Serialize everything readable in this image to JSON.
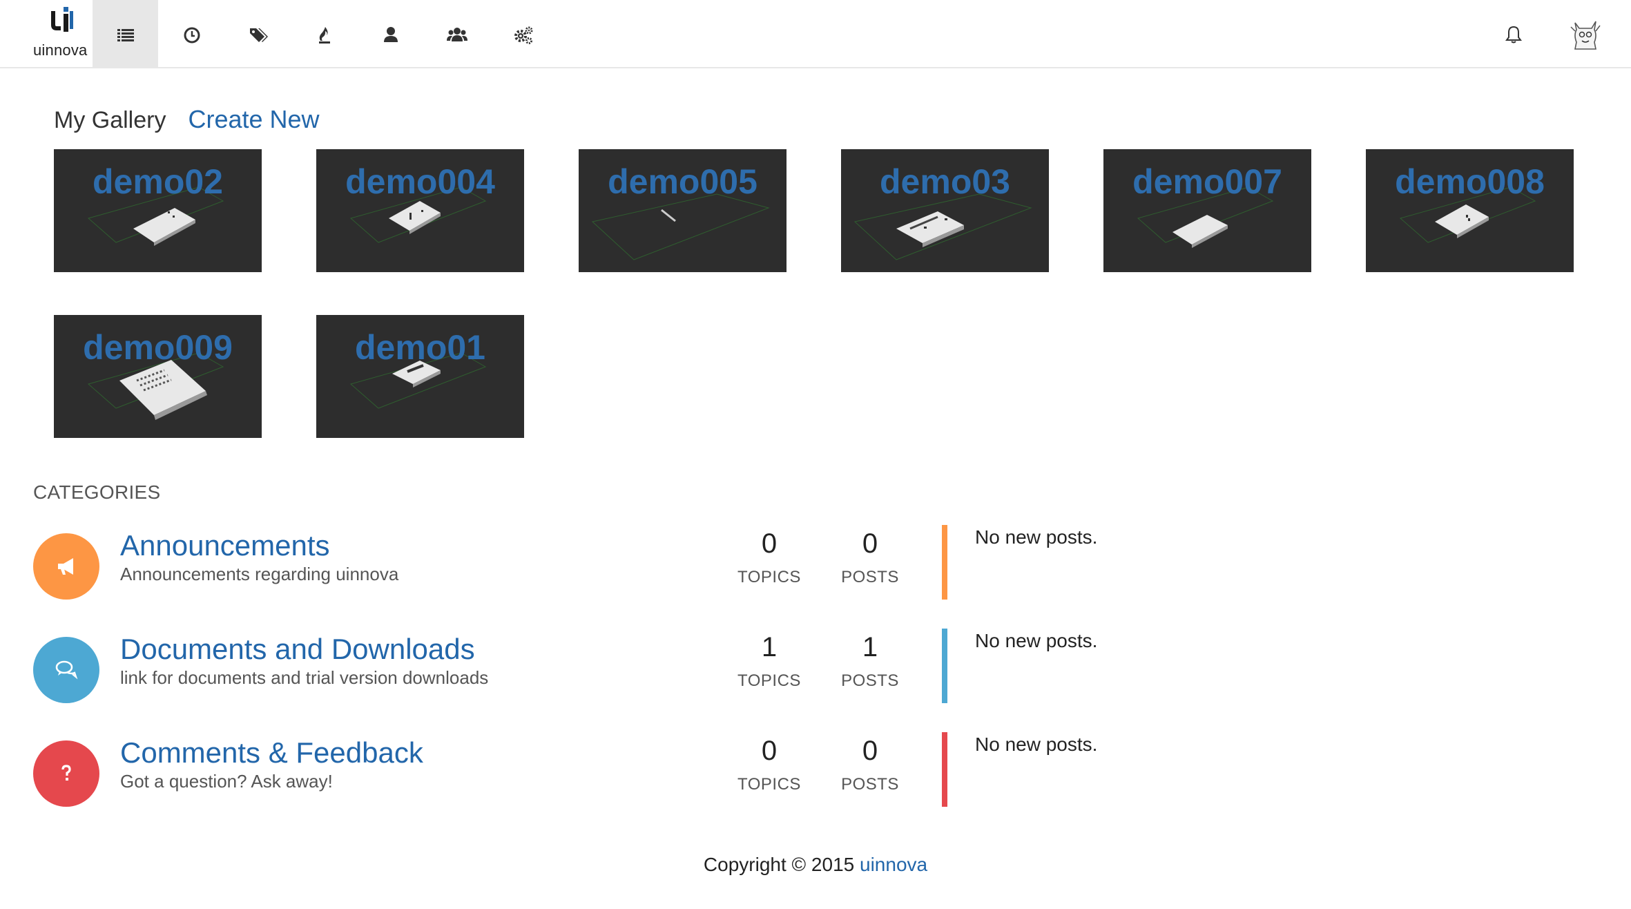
{
  "brand": {
    "name": "uinnova",
    "logo_icon": "uinnova-logo-icon"
  },
  "nav": {
    "items": [
      {
        "icon": "list-icon",
        "active": true
      },
      {
        "icon": "clock-icon",
        "active": false
      },
      {
        "icon": "tags-icon",
        "active": false
      },
      {
        "icon": "fire-icon",
        "active": false
      },
      {
        "icon": "user-icon",
        "active": false
      },
      {
        "icon": "users-icon",
        "active": false
      },
      {
        "icon": "gears-icon",
        "active": false
      }
    ],
    "right": [
      {
        "icon": "bell-icon"
      },
      {
        "icon": "avatar"
      }
    ]
  },
  "gallery": {
    "title": "My Gallery",
    "create_label": "Create New",
    "items": [
      {
        "label": "demo02"
      },
      {
        "label": "demo004"
      },
      {
        "label": "demo005"
      },
      {
        "label": "demo03"
      },
      {
        "label": "demo007"
      },
      {
        "label": "demo008"
      },
      {
        "label": "demo009"
      },
      {
        "label": "demo01"
      }
    ]
  },
  "categories": {
    "heading": "CATEGORIES",
    "items": [
      {
        "title": "Announcements",
        "description": "Announcements regarding uinnova",
        "topics": "0",
        "posts": "0",
        "topics_label": "TOPICS",
        "posts_label": "POSTS",
        "last_post": "No new posts.",
        "color": "#fd9644",
        "icon": "bullhorn-icon"
      },
      {
        "title": "Documents and Downloads",
        "description": "link for documents and trial version downloads",
        "topics": "1",
        "posts": "1",
        "topics_label": "TOPICS",
        "posts_label": "POSTS",
        "last_post": "No new posts.",
        "color": "#4da8d3",
        "icon": "comments-icon"
      },
      {
        "title": "Comments & Feedback",
        "description": "Got a question? Ask away!",
        "topics": "0",
        "posts": "0",
        "topics_label": "TOPICS",
        "posts_label": "POSTS",
        "last_post": "No new posts.",
        "color": "#e5484d",
        "icon": "question-icon"
      }
    ]
  },
  "footer": {
    "text": "Copyright © 2015 ",
    "link": "uinnova"
  }
}
